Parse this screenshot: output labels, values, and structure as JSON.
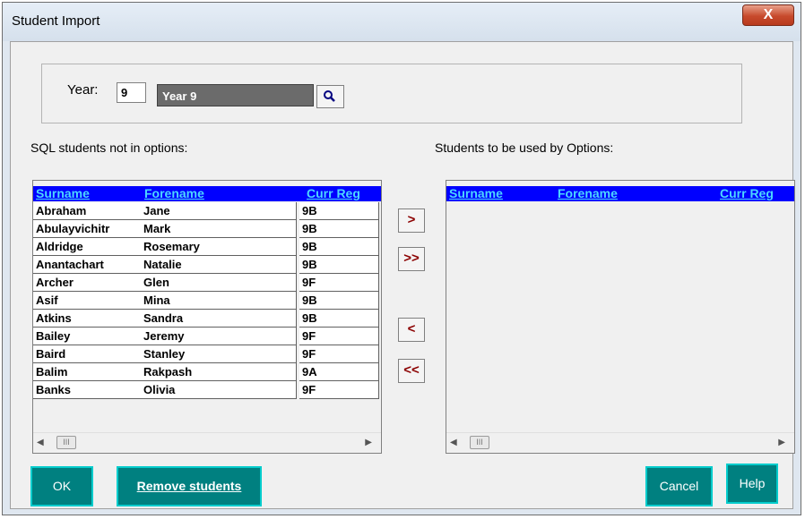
{
  "window": {
    "title": "Student Import",
    "close_label": "X"
  },
  "year": {
    "label": "Year:",
    "value": "9",
    "name": "Year 9"
  },
  "left_list": {
    "label": "SQL students not in options:",
    "columns": [
      "Surname",
      "Forename",
      "Curr Reg"
    ],
    "rows": [
      [
        "Abraham",
        "Jane",
        "9B"
      ],
      [
        "Abulayvichitr",
        "Mark",
        "9B"
      ],
      [
        "Aldridge",
        "Rosemary",
        "9B"
      ],
      [
        "Anantachart",
        "Natalie",
        "9B"
      ],
      [
        "Archer",
        "Glen",
        "9F"
      ],
      [
        "Asif",
        "Mina",
        "9B"
      ],
      [
        "Atkins",
        "Sandra",
        "9B"
      ],
      [
        "Bailey",
        "Jeremy",
        "9F"
      ],
      [
        "Baird",
        "Stanley",
        "9F"
      ],
      [
        "Balim",
        "Rakpash",
        "9A"
      ],
      [
        "Banks",
        "Olivia",
        "9F"
      ]
    ]
  },
  "right_list": {
    "label": "Students to be used by Options:",
    "columns": [
      "Surname",
      "Forename",
      "Curr Reg"
    ]
  },
  "move_buttons": {
    "add_one": ">",
    "add_all": ">>",
    "remove_one": "<",
    "remove_all": "<<"
  },
  "buttons": {
    "ok": "OK",
    "remove_students": "Remove students",
    "cancel": "Cancel",
    "help": "Help"
  },
  "scrollbar": {
    "thumb_glyph": "III"
  }
}
